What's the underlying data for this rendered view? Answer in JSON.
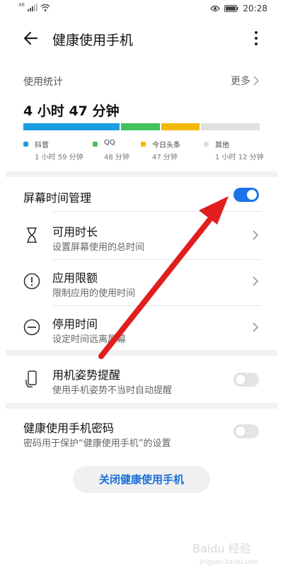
{
  "status": {
    "signal_label": "46",
    "time": "20:28"
  },
  "header": {
    "title": "健康使用手机"
  },
  "usage": {
    "label": "使用统计",
    "more": "更多",
    "total": "4 小时 47 分钟",
    "apps": [
      {
        "name": "抖音",
        "duration": "1 小时 59 分钟",
        "color": "#1a9de1",
        "share": 0.415
      },
      {
        "name": "QQ",
        "duration": "48 分钟",
        "color": "#43c15f",
        "share": 0.167
      },
      {
        "name": "今日头条",
        "duration": "47 分钟",
        "color": "#f5b800",
        "share": 0.164
      },
      {
        "name": "其他",
        "duration": "1 小时 12 分钟",
        "color": "#e0e0e0",
        "share": 0.254
      }
    ]
  },
  "screen_time": {
    "title": "屏幕时间管理",
    "enabled": true,
    "items": [
      {
        "title": "可用时长",
        "subtitle": "设置屏幕使用的总时间",
        "icon": "hourglass-icon"
      },
      {
        "title": "应用限额",
        "subtitle": "限制应用的使用时间",
        "icon": "alert-circle-icon"
      },
      {
        "title": "停用时间",
        "subtitle": "设定时间远离屏幕",
        "icon": "minus-circle-icon"
      }
    ]
  },
  "posture": {
    "title": "用机姿势提醒",
    "subtitle": "使用手机姿势不当时自动提醒",
    "enabled": false,
    "icon": "phone-hand-icon"
  },
  "password": {
    "title": "健康使用手机密码",
    "subtitle": "密码用于保护“健康使用手机”的设置",
    "enabled": false
  },
  "close_button": "关闭健康使用手机",
  "watermark": {
    "text": "Baidu 经验",
    "url": "jingyan.baidu.com"
  },
  "colors": {
    "accent": "#1a73e8",
    "annotation_arrow": "#e01e1e"
  }
}
